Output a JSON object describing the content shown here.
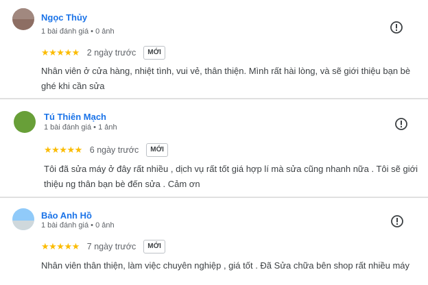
{
  "reviews": [
    {
      "name": "Ngọc Thủy",
      "meta": "1 bài đánh giá • 0 ảnh",
      "stars": "★★★★★",
      "date": "2 ngày trước",
      "badge": "MỚI",
      "text": "Nhân viên ở cửa hàng, nhiệt tình, vui vẻ, thân thiện. Mình rất hài lòng, và sẽ giới thiệu bạn bè ghé khi cần sửa",
      "avatar_color": "#8d6e63",
      "rating": 5
    },
    {
      "name": "Tú Thiên Mạch",
      "meta": "1 bài đánh giá • 1 ảnh",
      "stars": "★★★★★",
      "date": "6 ngày trước",
      "badge": "MỚI",
      "text": "Tôi đã sửa máy ở đây rất nhiều , dịch vụ rất tốt giá hợp lí mà sửa cũng nhanh nữa . Tôi sẽ giới thiệu ng thân bạn bè đến sửa . Cảm ơn",
      "avatar_color": "#689f38",
      "rating": 5
    },
    {
      "name": "Bảo Anh Hồ",
      "meta": "1 bài đánh giá • 0 ảnh",
      "stars": "★★★★★",
      "date": "7 ngày trước",
      "badge": "MỚI",
      "text": "Nhân viên thân thiện, làm việc chuyên nghiệp , giá tốt . Đã Sửa chữa bên shop rất nhiều máy",
      "avatar_color": "#90caf9",
      "rating": 5
    }
  ],
  "icons": {
    "info": "info-icon"
  },
  "colors": {
    "star": "#fbbc04",
    "name": "#1a73e8"
  }
}
